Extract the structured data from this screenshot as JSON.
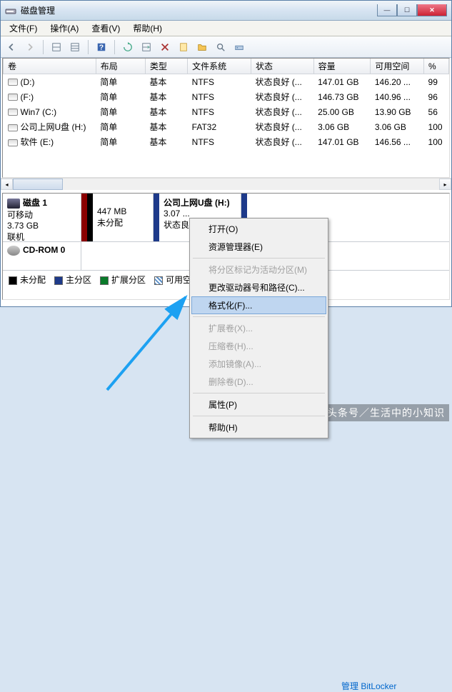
{
  "window": {
    "title": "磁盘管理"
  },
  "menus": {
    "file": "文件(F)",
    "action": "操作(A)",
    "view": "查看(V)",
    "help": "帮助(H)"
  },
  "columns": {
    "vol": "卷",
    "layout": "布局",
    "type": "类型",
    "fs": "文件系统",
    "status": "状态",
    "capacity": "容量",
    "free": "可用空间",
    "pct": "%"
  },
  "volumes": [
    {
      "name": "(D:)",
      "layout": "简单",
      "type": "基本",
      "fs": "NTFS",
      "status": "状态良好 (...",
      "capacity": "147.01 GB",
      "free": "146.20 ...",
      "pct": "99"
    },
    {
      "name": "(F:)",
      "layout": "简单",
      "type": "基本",
      "fs": "NTFS",
      "status": "状态良好 (...",
      "capacity": "146.73 GB",
      "free": "140.96 ...",
      "pct": "96"
    },
    {
      "name": "Win7 (C:)",
      "layout": "简单",
      "type": "基本",
      "fs": "NTFS",
      "status": "状态良好 (...",
      "capacity": "25.00 GB",
      "free": "13.90 GB",
      "pct": "56"
    },
    {
      "name": "公司上网U盘 (H:)",
      "layout": "简单",
      "type": "基本",
      "fs": "FAT32",
      "status": "状态良好 (...",
      "capacity": "3.06 GB",
      "free": "3.06 GB",
      "pct": "100"
    },
    {
      "name": "软件 (E:)",
      "layout": "简单",
      "type": "基本",
      "fs": "NTFS",
      "status": "状态良好 (...",
      "capacity": "147.01 GB",
      "free": "146.56 ...",
      "pct": "100"
    }
  ],
  "disk1": {
    "label": "磁盘 1",
    "removable": "可移动",
    "size": "3.73 GB",
    "status": "联机",
    "p1": {
      "size": "447 MB",
      "status": "未分配"
    },
    "p2": {
      "name": "公司上网U盘 (H:)",
      "size": "3.07 ...",
      "status": "状态良..."
    }
  },
  "cdrom": {
    "label": "CD-ROM 0"
  },
  "legend": {
    "unalloc": "未分配",
    "primary": "主分区",
    "ext": "扩展分区",
    "free": "可用空间"
  },
  "ctx": {
    "open": "打开(O)",
    "explorer": "资源管理器(E)",
    "mark": "将分区标记为活动分区(M)",
    "change": "更改驱动器号和路径(C)...",
    "format": "格式化(F)...",
    "extend": "扩展卷(X)...",
    "shrink": "压缩卷(H)...",
    "mirror": "添加镜像(A)...",
    "delete": "删除卷(D)...",
    "props": "属性(P)",
    "help": "帮助(H)"
  },
  "bglink": "管理 BitLocker",
  "watermark": "头条号／生活中的小知识"
}
